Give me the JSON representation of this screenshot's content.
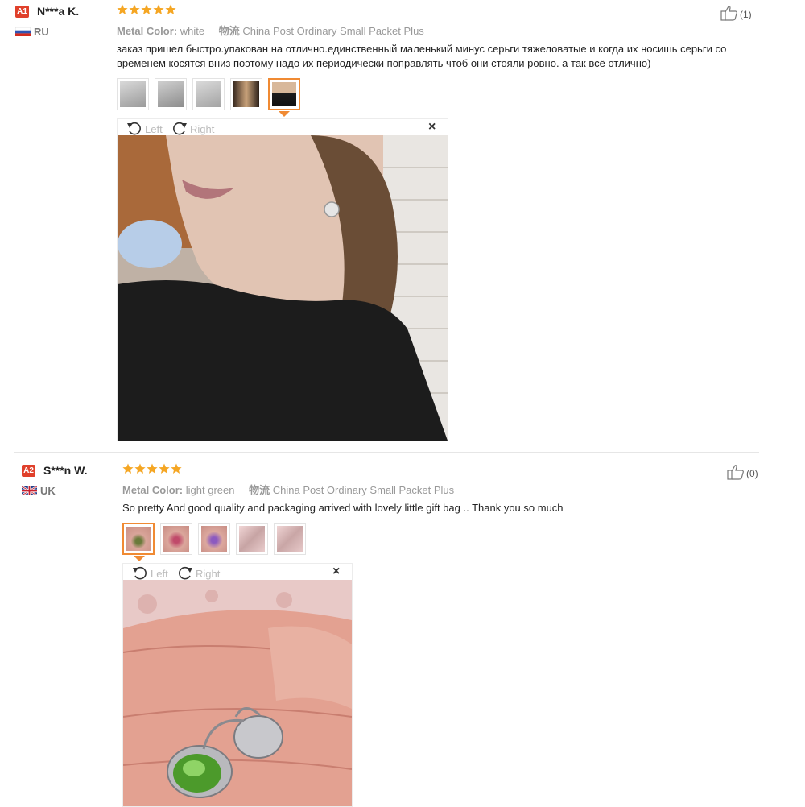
{
  "colors": {
    "accent": "#f08a33",
    "star": "#f5a623",
    "badge": "#e0402b"
  },
  "reviews": [
    {
      "level": "A1",
      "user": "N***a K.",
      "country": "RU",
      "flag_icon": "russia-flag-icon",
      "rating": 5,
      "likes": "(1)",
      "attr_label": "Metal Color:",
      "attr_value": "white",
      "ship_label": "物流",
      "ship_value": "China Post Ordinary Small Packet Plus",
      "text": "заказ пришел быстро.упакован на отлично.единственный маленький минус серьги тяжеловатые и когда их носишь серьги со временем косятся вниз поэтому надо их периодически поправлять чтоб они стояли ровно. а так всё отлично)",
      "thumbs_count": 5,
      "active_thumb": 5,
      "rotate_left": "Left",
      "rotate_right": "Right",
      "close": "×"
    },
    {
      "level": "A2",
      "user": "S***n W.",
      "country": "UK",
      "flag_icon": "uk-flag-icon",
      "rating": 5,
      "likes": "(0)",
      "attr_label": "Metal Color:",
      "attr_value": "light green",
      "ship_label": "物流",
      "ship_value": "China Post Ordinary Small Packet Plus",
      "text": "So pretty And good quality and packaging arrived with lovely little gift bag .. Thank you so much",
      "thumbs_count": 5,
      "active_thumb": 1,
      "rotate_left": "Left",
      "rotate_right": "Right",
      "close": "×"
    }
  ]
}
